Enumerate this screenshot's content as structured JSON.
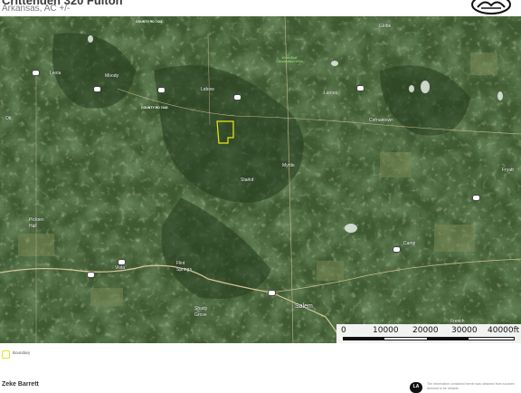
{
  "header": {
    "title": "Crittenden 320 Fulton",
    "subtitle": "Arkansas, AC +/-"
  },
  "map": {
    "places": [
      {
        "key": "globe",
        "label": "Globe"
      },
      {
        "key": "leola",
        "label": "Leola"
      },
      {
        "key": "moody",
        "label": "Moody"
      },
      {
        "key": "lebow",
        "label": "Lebow"
      },
      {
        "key": "lantoh",
        "label": "Lanton"
      },
      {
        "key": "cornantown",
        "label": "Cornantown"
      },
      {
        "key": "ott",
        "label": "Ott"
      },
      {
        "key": "myrtle",
        "label": "Myrtle"
      },
      {
        "key": "starkit",
        "label": "Starkit"
      },
      {
        "key": "fryatt",
        "label": "Fryatt"
      },
      {
        "key": "pickren",
        "label": "Pickren\nHall"
      },
      {
        "key": "camp",
        "label": "Camp"
      },
      {
        "key": "viola",
        "label": "Viola"
      },
      {
        "key": "flint",
        "label": "Flint\nSprings"
      },
      {
        "key": "shady",
        "label": "Shady\nGrove"
      },
      {
        "key": "salem",
        "label": "Salem"
      },
      {
        "key": "french",
        "label": "French"
      }
    ],
    "wma_label": "White Bluff\nConservation WMA",
    "road_labels": [
      "COUNTY RD 7441",
      "COUNTY RD 7443"
    ],
    "colors": {
      "boundary": "#f1e71a",
      "base": "#3c5a30",
      "road": "#d9c99a"
    }
  },
  "scalebar": {
    "ticks": [
      "0",
      "10000",
      "20000",
      "30000",
      "40000ft"
    ]
  },
  "legend": {
    "label": "Boundary",
    "color": "#f1e71a"
  },
  "footer": {
    "agent_name": "Zeke Barrett",
    "disclaimer": "The information contained herein was obtained from sources deemed to be reliable.",
    "logo_text": "LA"
  }
}
